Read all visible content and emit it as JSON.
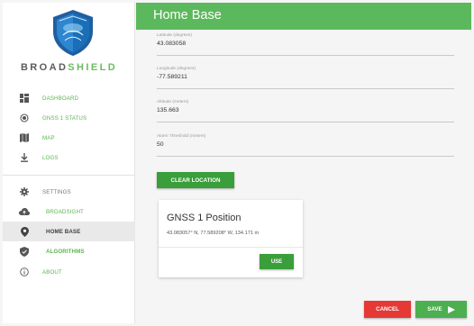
{
  "app": {
    "brand_part1": "BROAD",
    "brand_part2": "SHIELD",
    "header_title": "Home Base"
  },
  "sidebar": {
    "items": [
      {
        "label": "DASHBOARD",
        "icon": "dashboard-icon"
      },
      {
        "label": "GNSS 1 STATUS",
        "icon": "target-icon"
      },
      {
        "label": "MAP",
        "icon": "map-icon"
      },
      {
        "label": "LOGS",
        "icon": "download-icon"
      },
      {
        "label": "SETTINGS",
        "icon": "gear-icon"
      },
      {
        "label": "BROADSIGHT",
        "icon": "cloud-upload-icon"
      },
      {
        "label": "HOME BASE",
        "icon": "location-pin-icon"
      },
      {
        "label": "ALGORITHMS",
        "icon": "shield-check-icon"
      },
      {
        "label": "ABOUT",
        "icon": "info-icon"
      }
    ],
    "active": "HOME BASE"
  },
  "form": {
    "latitude": {
      "label": "Latitude (degrees)",
      "value": "43.083058"
    },
    "longitude": {
      "label": "Longitude (degrees)",
      "value": "-77.589211"
    },
    "altitude": {
      "label": "Altitude (meters)",
      "value": "135.663"
    },
    "alarm": {
      "label": "Alarm Threshold (meters)",
      "value": "50"
    },
    "clear_label": "CLEAR LOCATION"
  },
  "card": {
    "title": "GNSS 1 Position",
    "position": "43.083057° N, 77.589208° W, 134.171 m",
    "use_label": "USE"
  },
  "actions": {
    "cancel_label": "CANCEL",
    "save_label": "SAVE"
  },
  "colors": {
    "header": "#5cb85c",
    "primary_button": "#3a9e3a",
    "cancel": "#e53935",
    "save": "#4caf50",
    "nav_label": "#5bb552"
  }
}
